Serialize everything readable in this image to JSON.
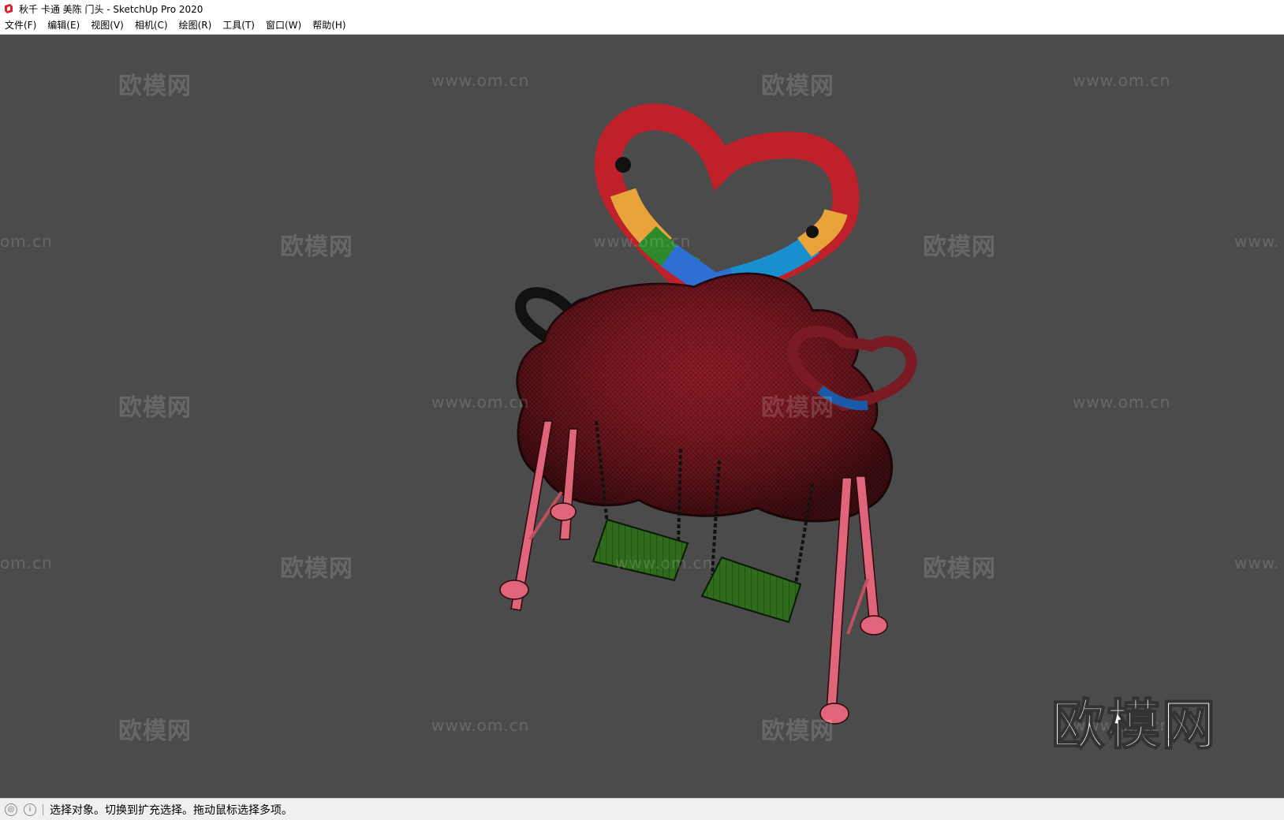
{
  "window": {
    "title": "秋千 卡通 美陈 门头 - SketchUp Pro 2020"
  },
  "menu": [
    "文件(F)",
    "编辑(E)",
    "视图(V)",
    "相机(C)",
    "绘图(R)",
    "工具(T)",
    "窗口(W)",
    "帮助(H)"
  ],
  "status": {
    "text": "选择对象。切换到扩充选择。拖动鼠标选择多项。"
  },
  "watermark": {
    "cn": "欧模网",
    "url": "www.om.cn",
    "cut_url_start": "om.cn",
    "cut_url_end": "www."
  },
  "logo": {
    "text": "欧模网"
  },
  "colors": {
    "cloud": "#8b1a24",
    "legs": "#e0647a",
    "seats": "#2f6b1c",
    "viewport": "#4b4b4b"
  }
}
